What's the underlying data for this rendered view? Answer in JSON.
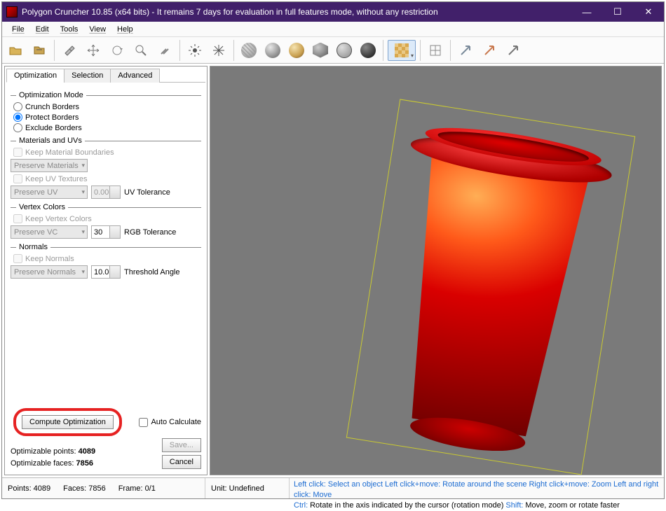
{
  "window": {
    "title": "Polygon Cruncher 10.85 (x64 bits) - It remains 7 days for evaluation in full features mode, without any restriction"
  },
  "menu": {
    "file": "File",
    "edit": "Edit",
    "tools": "Tools",
    "view": "View",
    "help": "Help"
  },
  "tabs": {
    "optimization": "Optimization",
    "selection": "Selection",
    "advanced": "Advanced"
  },
  "optMode": {
    "legend": "Optimization Mode",
    "crunch": "Crunch Borders",
    "protect": "Protect Borders",
    "exclude": "Exclude Borders"
  },
  "materials": {
    "legend": "Materials and UVs",
    "keepBoundaries": "Keep Material Boundaries",
    "preserveMat": "Preserve Materials",
    "keepUV": "Keep UV Textures",
    "preserveUV": "Preserve UV",
    "uvTol": "0.00",
    "uvTolLabel": "UV Tolerance"
  },
  "vcolors": {
    "legend": "Vertex Colors",
    "keep": "Keep Vertex Colors",
    "preserve": "Preserve VC",
    "rgbVal": "30",
    "rgbLabel": "RGB Tolerance"
  },
  "normals": {
    "legend": "Normals",
    "keep": "Keep Normals",
    "preserve": "Preserve Normals",
    "thVal": "10.0",
    "thLabel": "Threshold Angle"
  },
  "actions": {
    "compute": "Compute Optimization",
    "auto": "Auto Calculate",
    "save": "Save...",
    "cancel": "Cancel"
  },
  "stats": {
    "optPointsLabel": "Optimizable points:",
    "optPoints": "4089",
    "optFacesLabel": "Optimizable faces:",
    "optFaces": "7856"
  },
  "status": {
    "points": "Points: 4089",
    "faces": "Faces: 7856",
    "frame": "Frame: 0/1",
    "unit": "Unit: Undefined",
    "lc": "Left click:",
    "lcV": "Select an object",
    "lcm": "Left click+move:",
    "lcmV": "Rotate around the scene",
    "rcm": "Right click+move:",
    "rcmV": "Zoom",
    "lrc": "Left and right click:",
    "lrcV": "Move",
    "ctrl": "Ctrl:",
    "ctrlV": "Rotate in the axis indicated by the cursor (rotation mode)",
    "shift": "Shift:",
    "shiftV": "Move, zoom or rotate faster"
  }
}
